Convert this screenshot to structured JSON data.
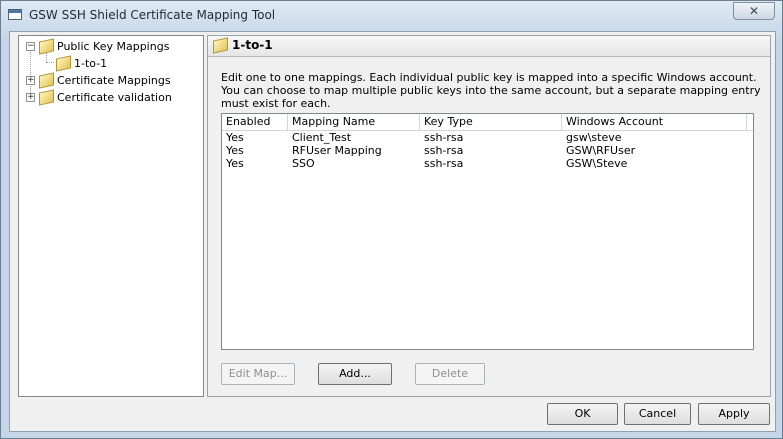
{
  "window": {
    "title": "GSW SSH Shield Certificate Mapping Tool",
    "close_glyph": "✕"
  },
  "tree": {
    "items": [
      {
        "label": "Public Key Mappings",
        "expander": "−"
      },
      {
        "label": "1-to-1"
      },
      {
        "label": "Certificate Mappings",
        "expander": "+"
      },
      {
        "label": "Certificate validation",
        "expander": "+"
      }
    ]
  },
  "panel": {
    "title": "1-to-1",
    "description": "Edit one to one mappings. Each individual public key  is mapped into a specific Windows account. You can choose to map multiple public keys into the same account, but a separate mapping entry must exist for each."
  },
  "table": {
    "columns": [
      "Enabled",
      "Mapping Name",
      "Key Type",
      "Windows Account"
    ],
    "rows": [
      [
        "Yes",
        "Client_Test",
        "ssh-rsa",
        "gsw\\steve"
      ],
      [
        "Yes",
        "RFUser Mapping",
        "ssh-rsa",
        "GSW\\RFUser"
      ],
      [
        "Yes",
        "SSO",
        "ssh-rsa",
        "GSW\\Steve"
      ]
    ]
  },
  "buttons": {
    "edit_map": "Edit Map...",
    "add": "Add...",
    "delete": "Delete",
    "ok": "OK",
    "cancel": "Cancel",
    "apply": "Apply"
  }
}
